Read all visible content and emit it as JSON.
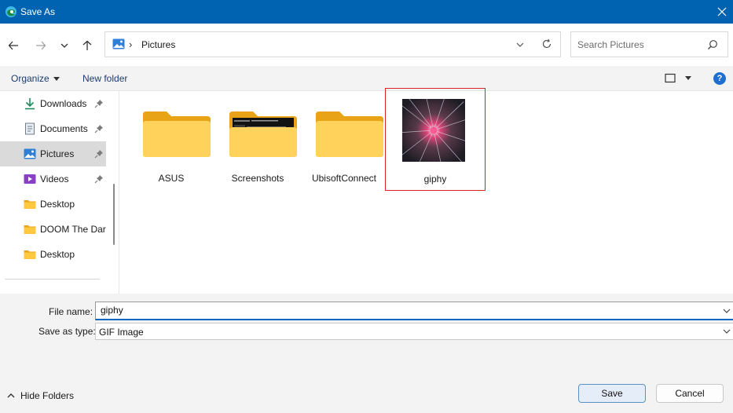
{
  "window": {
    "title": "Save As"
  },
  "nav": {
    "back_icon": "back-arrow-icon",
    "forward_icon": "forward-arrow-icon",
    "recent_icon": "chevron-down-icon",
    "up_icon": "up-arrow-icon"
  },
  "address": {
    "separator": "›",
    "current": "Pictures"
  },
  "search": {
    "placeholder": "Search Pictures"
  },
  "toolbar": {
    "organize_label": "Organize",
    "new_folder_label": "New folder",
    "help_label": "?"
  },
  "sidebar": {
    "items": [
      {
        "label": "Downloads",
        "icon": "download-icon",
        "pinned": true
      },
      {
        "label": "Documents",
        "icon": "document-icon",
        "pinned": true
      },
      {
        "label": "Pictures",
        "icon": "pictures-icon",
        "pinned": true,
        "selected": true
      },
      {
        "label": "Videos",
        "icon": "video-icon",
        "pinned": true
      },
      {
        "label": "Desktop",
        "icon": "folder-icon",
        "pinned": false
      },
      {
        "label": "DOOM  The Dar",
        "icon": "folder-icon",
        "pinned": false
      },
      {
        "label": "Desktop",
        "icon": "folder-icon",
        "pinned": false
      }
    ]
  },
  "files": [
    {
      "name": "ASUS",
      "kind": "folder"
    },
    {
      "name": "Screenshots",
      "kind": "folder-with-preview"
    },
    {
      "name": "UbisoftConnect",
      "kind": "folder"
    },
    {
      "name": "giphy",
      "kind": "image",
      "selected": true
    }
  ],
  "form": {
    "filename_label": "File name:",
    "filename_value": "giphy",
    "savetype_label": "Save as type:",
    "savetype_value": "GIF Image"
  },
  "footer": {
    "hide_folders_label": "Hide Folders",
    "save_label": "Save",
    "cancel_label": "Cancel"
  },
  "colors": {
    "titlebar": "#0063b1",
    "selection_border": "#d9232b",
    "folder_yellow": "#ffc83d",
    "accent": "#0067c0"
  }
}
